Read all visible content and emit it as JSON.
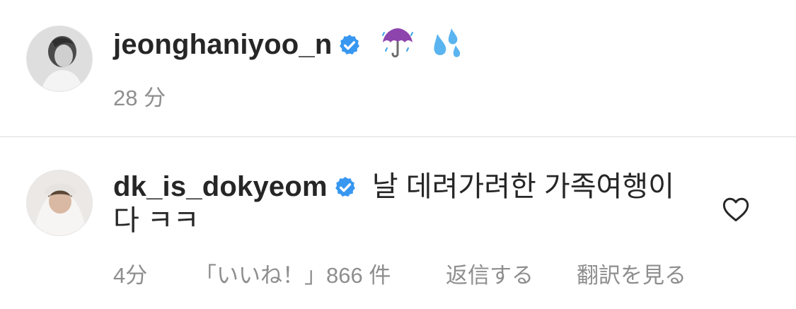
{
  "comments": [
    {
      "username": "jeonghaniyoo_n",
      "text": "☔ 💦",
      "text_line2": "",
      "time": "28 分",
      "likes": "",
      "reply": "",
      "translate": ""
    },
    {
      "username": "dk_is_dokyeom",
      "text": "날 데려가려한 가족여행이",
      "text_line2": "다 ㅋㅋ",
      "time": "4分",
      "likes": "「いいね！」866 件",
      "reply": "返信する",
      "translate": "翻訳を見る"
    }
  ],
  "colors": {
    "verified_badge": "#3897f0",
    "secondary_text": "#8e8e8e",
    "divider": "#dbdbdb"
  },
  "icons": {
    "verified": "verified-badge-icon",
    "like": "heart-outline-icon"
  }
}
